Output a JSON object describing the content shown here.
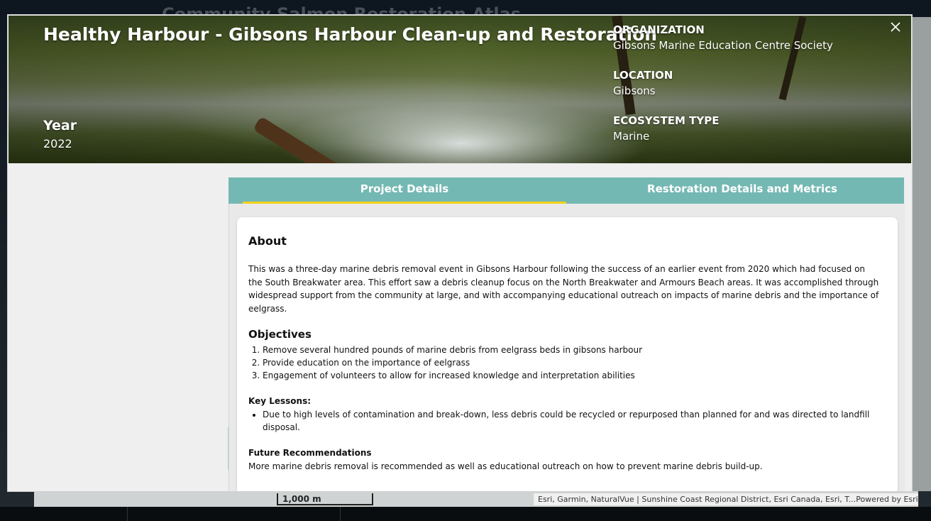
{
  "background": {
    "app_title": "Community Salmon Restoration Atlas",
    "scale_label": "1,000 m",
    "attribution": "Esri, Garmin, NaturalVue | Sunshine Coast Regional District, Esri Canada, Esri, T...",
    "powered_by": "Powered by Esri"
  },
  "hero": {
    "title": "Healthy Harbour - Gibsons Harbour Clean-up and Restoration",
    "year_label": "Year",
    "year_value": "2022",
    "organization_label": "ORGANIZATION",
    "organization_value": "Gibsons Marine Education Centre Society",
    "location_label": "LOCATION",
    "location_value": "Gibsons",
    "ecosystem_label": "ECOSYSTEM TYPE",
    "ecosystem_value": "Marine",
    "close_icon": "close-icon"
  },
  "tabs": [
    {
      "label": "Project Details",
      "active": true
    },
    {
      "label": "Restoration Details and Metrics",
      "active": false
    }
  ],
  "details": {
    "about_heading": "About",
    "about_text": "This was a three-day marine debris removal event in Gibsons Harbour following the success of an earlier event from 2020 which had focused on the South Breakwater area. This effort saw a debris cleanup focus on the North Breakwater and Armours Beach areas. It was accomplished through widespread support from the community at large, and with accompanying educational outreach on impacts of marine debris and the importance of eelgrass.",
    "objectives_heading": "Objectives",
    "objectives": [
      "Remove several hundred pounds of marine debris from eelgrass beds in gibsons harbour",
      "Provide education on the importance of eelgrass",
      "Engagement of volunteers to allow for increased knowledge and interpretation abilities"
    ],
    "key_lessons_heading": "Key Lessons:",
    "key_lessons": [
      "Due to high levels of contamination and break-down, less debris could be recycled or repurposed than planned for and was directed to landfill disposal."
    ],
    "future_heading": "Future Recommendations",
    "future_text": "More marine debris removal is recommended as well as educational outreach on how to prevent marine debris build-up."
  },
  "colors": {
    "tab_bg": "#74b8b3",
    "tab_active_underline": "#f2d21b"
  }
}
